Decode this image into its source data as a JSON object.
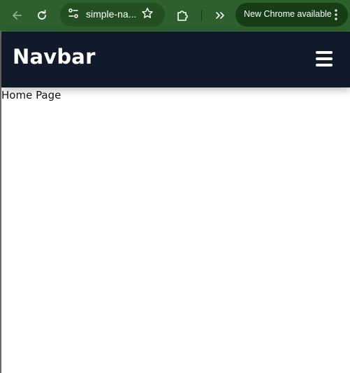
{
  "browser": {
    "url_display": "simple-na...",
    "notice_label": "New Chrome available",
    "accent_color": "#2e5f2e"
  },
  "icons": {
    "back": "back-arrow-icon",
    "reload": "reload-icon",
    "site_info": "tune-icon",
    "bookmark": "star-icon",
    "extensions": "puzzle-icon",
    "overflow": "chevron-double-right-icon",
    "menu": "vertical-dots-icon",
    "nav_menu": "hamburger-icon"
  },
  "site": {
    "brand": "Navbar",
    "navbar_color": "#111a2a",
    "content": "Home Page"
  }
}
